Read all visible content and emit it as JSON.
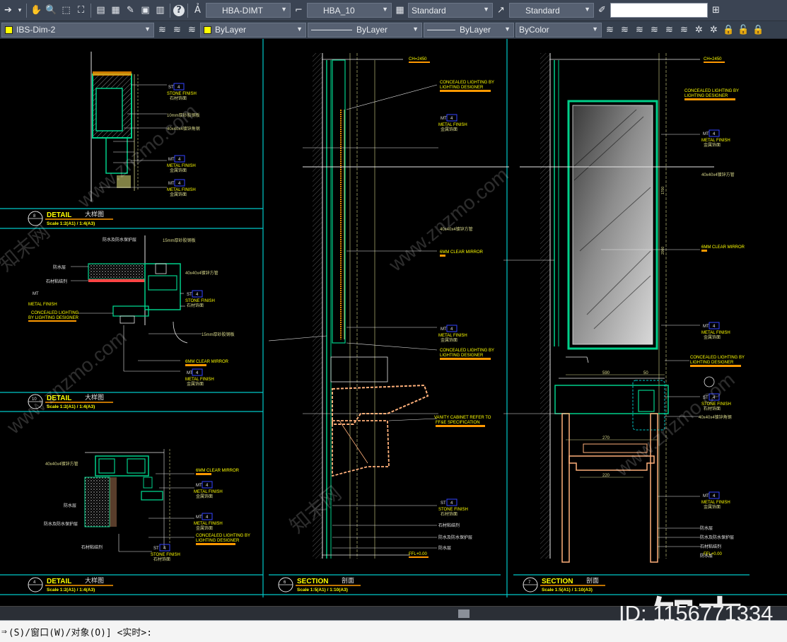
{
  "toolbar_top": {
    "dimstyle": "HBA-DIMT",
    "textstyle": "HBA_10",
    "tablestyle": "Standard",
    "mleaderstyle": "Standard",
    "search_value": ""
  },
  "toolbar_props": {
    "layer": "IBS-Dim-2",
    "color": "ByLayer",
    "linetype": "ByLayer",
    "lineweight": "ByLayer",
    "plotstyle": "ByColor"
  },
  "colors": {
    "frame": "#00c8c8",
    "title": "#ffff00",
    "accent": "#ff9900",
    "material_tag": "#3344ff",
    "dim": "#d9d98c",
    "fixture": "#ffb07a",
    "green": "#00d08a",
    "white_line": "#e6e6e6"
  },
  "detail_a": {
    "number": "8",
    "title": "DETAIL",
    "title_cn": "大样图",
    "scale": "Scale 1:2(A1) / 1:4(A3)",
    "tags": [
      {
        "code": "ST",
        "num": "4",
        "label": "STONE FINISH",
        "cn": "石材饰面"
      },
      {
        "code": "MT",
        "num": "4",
        "label": "METAL FINISH",
        "cn": "金属饰面"
      },
      {
        "code": "MT",
        "num": "4",
        "label": "METAL FINISH",
        "cn": "金属饰面"
      }
    ],
    "notes": [
      "10mm厚砂胶钢板",
      "40x40x4镀锌角钢"
    ]
  },
  "detail_b": {
    "number": "10",
    "title": "DETAIL",
    "title_cn": "大样图",
    "scale": "Scale 1:2(A1) / 1:4(A3)",
    "notes": [
      "防水及防水保护层",
      "15mm厚砂胶钢板",
      "防水层",
      "石材粘结剂",
      "40x40x4镀锌方管",
      "15mm厚砂胶钢板",
      "6MM CLEAR MIRROR"
    ],
    "lighting": [
      "CONCEALED LIGHTING",
      "BY LIGHTING DESIGNER"
    ],
    "tags": [
      {
        "code": "ST",
        "num": "4",
        "label": "STONE FINISH",
        "cn": "石材饰面"
      },
      {
        "code": "MT",
        "num": "4",
        "label": "METAL FINISH",
        "cn": "金属饰面"
      },
      {
        "code": "MT",
        "num": "4",
        "label": "METAL FINISH",
        "cn": "金属饰面"
      }
    ]
  },
  "detail_c": {
    "number": "4",
    "title": "DETAIL",
    "title_cn": "大样图",
    "scale": "Scale 1:2(A1) / 1:4(A3)",
    "notes": [
      "40x40x4镀锌方管",
      "防水层",
      "防水及防水保护层",
      "石材粘结剂",
      "6MM CLEAR MIRROR",
      "CONCEALED LIGHTING BY",
      "LIGHTING DESIGNER"
    ],
    "tags": [
      {
        "code": "MT",
        "num": "4",
        "label": "METAL FINISH",
        "cn": "金属饰面"
      },
      {
        "code": "MT",
        "num": "4",
        "label": "METAL FINISH",
        "cn": "金属饰面"
      },
      {
        "code": "ST",
        "num": "4",
        "label": "STONE FINISH",
        "cn": "石材饰面"
      }
    ]
  },
  "section_a": {
    "number": "6",
    "title": "SECTION",
    "title_cn": "剖面",
    "scale": "Scale 1:5(A1) / 1:10(A3)",
    "ch_label": "CH=2450",
    "ffl_label": "FFL+0.00",
    "notes": [
      "CONCEALED LIGHTING BY",
      "LIGHTING DESIGNER",
      "6MM CLEAR MIRROR",
      "CONCEALED LIGHTING BY",
      "LIGHTING DESIGNER",
      "VANITY CABINET REFER TO",
      "FF&E SPECIFICATION",
      "石材粘结剂",
      "防水及防水保护层",
      "防水层",
      "40x40x4镀锌方管"
    ],
    "tags": [
      {
        "code": "MT",
        "num": "4",
        "label": "METAL FINISH",
        "cn": "金属饰面"
      },
      {
        "code": "MT",
        "num": "4",
        "label": "METAL FINISH",
        "cn": "金属饰面"
      },
      {
        "code": "ST",
        "num": "4",
        "label": "STONE FINISH",
        "cn": "石材饰面"
      }
    ]
  },
  "section_b": {
    "number": "7",
    "title": "SECTION",
    "title_cn": "剖面",
    "scale": "Scale 1:5(A1) / 1:10(A3)",
    "ch_label": "CH=2450",
    "ffl_label": "FFL+0.00",
    "notes": [
      "CONCEALED LIGHTING BY",
      "LIGHTING DESIGNER",
      "40x40x4镀锌方管",
      "6MM CLEAR MIRROR",
      "CONCEALED LIGHTING BY",
      "LIGHTING DESIGNER",
      "40x40x4镀锌角钢",
      "防水层",
      "防水及防水保护层",
      "石材粘结剂",
      "防水层"
    ],
    "tags": [
      {
        "code": "MT",
        "num": "4",
        "label": "METAL FINISH",
        "cn": "金属饰面"
      },
      {
        "code": "MT",
        "num": "4",
        "label": "METAL FINISH",
        "cn": "金属饰面"
      },
      {
        "code": "ST",
        "num": "4",
        "label": "STONE FINISH",
        "cn": "石材饰面"
      },
      {
        "code": "MT",
        "num": "4",
        "label": "METAL FINISH",
        "cn": "金属饰面"
      }
    ],
    "dims": [
      "590",
      "50",
      "270",
      "220",
      "1700",
      "2000"
    ]
  },
  "command": {
    "prompt": "(S)/窗口(W)/对象(O)] <实时>:"
  },
  "watermark": {
    "logo": "知末",
    "id_text": "ID: 1156771334",
    "site": "www.znzmo.com",
    "cn": "知末网"
  }
}
